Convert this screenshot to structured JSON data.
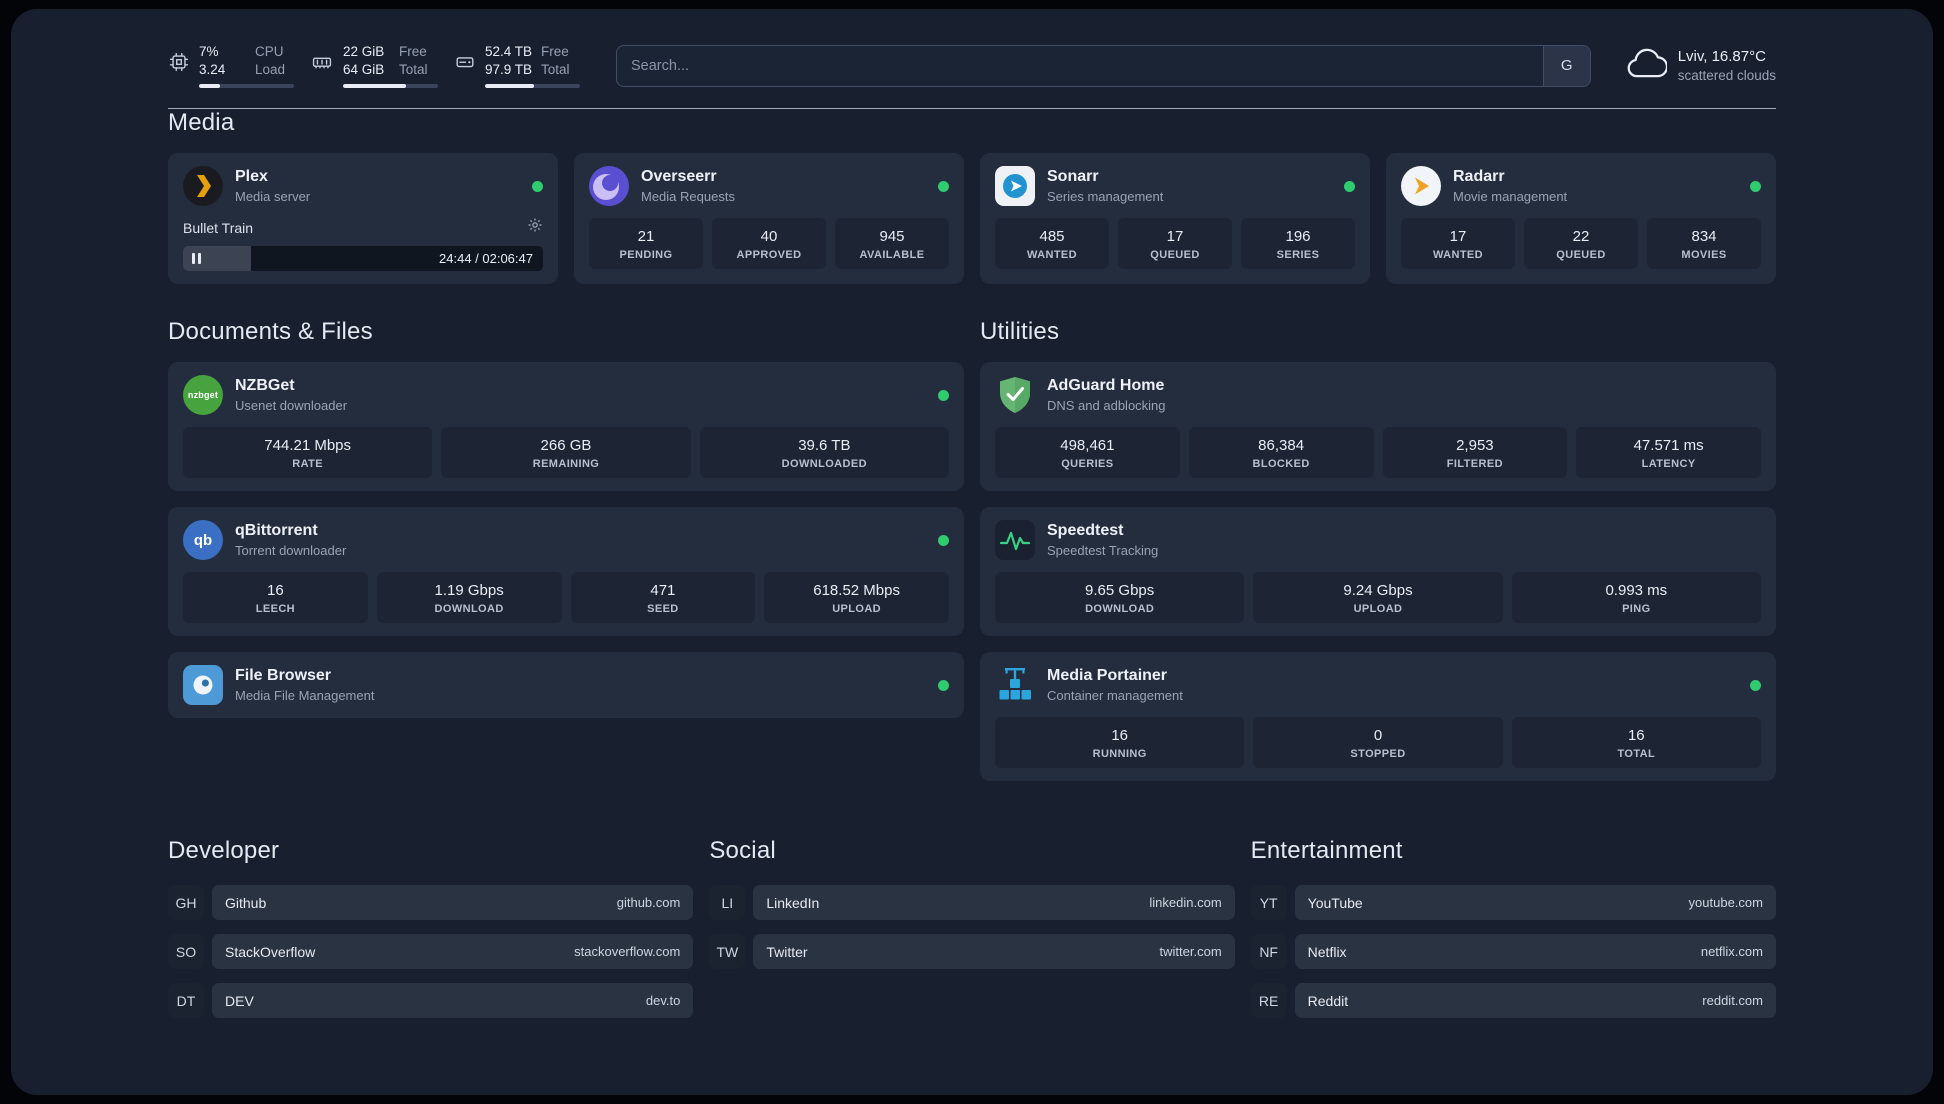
{
  "topbar": {
    "stats": [
      {
        "row1_value": "7%",
        "row1_label": "CPU",
        "row2_value": "3.24",
        "row2_label": "Load",
        "progress": 22
      },
      {
        "row1_value": "22 GiB",
        "row1_label": "Free",
        "row2_value": "64 GiB",
        "row2_label": "Total",
        "progress": 66
      },
      {
        "row1_value": "52.4 TB",
        "row1_label": "Free",
        "row2_value": "97.9 TB",
        "row2_label": "Total",
        "progress": 52
      }
    ],
    "search": {
      "placeholder": "Search...",
      "button_label": "G"
    },
    "weather": {
      "location": "Lviv, 16.87°C",
      "condition": "scattered clouds"
    }
  },
  "media": {
    "heading": "Media",
    "plex": {
      "name": "Plex",
      "subtitle": "Media server",
      "now_playing": "Bullet Train",
      "time": "24:44 / 02:06:47",
      "progress": 19
    },
    "overseerr": {
      "name": "Overseerr",
      "subtitle": "Media Requests",
      "stats": [
        {
          "value": "21",
          "label": "PENDING"
        },
        {
          "value": "40",
          "label": "APPROVED"
        },
        {
          "value": "945",
          "label": "AVAILABLE"
        }
      ]
    },
    "sonarr": {
      "name": "Sonarr",
      "subtitle": "Series management",
      "stats": [
        {
          "value": "485",
          "label": "WANTED"
        },
        {
          "value": "17",
          "label": "QUEUED"
        },
        {
          "value": "196",
          "label": "SERIES"
        }
      ]
    },
    "radarr": {
      "name": "Radarr",
      "subtitle": "Movie management",
      "stats": [
        {
          "value": "17",
          "label": "WANTED"
        },
        {
          "value": "22",
          "label": "QUEUED"
        },
        {
          "value": "834",
          "label": "MOVIES"
        }
      ]
    }
  },
  "documents": {
    "heading": "Documents & Files",
    "nzbget": {
      "name": "NZBGet",
      "subtitle": "Usenet downloader",
      "stats": [
        {
          "value": "744.21 Mbps",
          "label": "RATE"
        },
        {
          "value": "266 GB",
          "label": "REMAINING"
        },
        {
          "value": "39.6 TB",
          "label": "DOWNLOADED"
        }
      ]
    },
    "qbittorrent": {
      "name": "qBittorrent",
      "subtitle": "Torrent downloader",
      "stats": [
        {
          "value": "16",
          "label": "LEECH"
        },
        {
          "value": "1.19 Gbps",
          "label": "DOWNLOAD"
        },
        {
          "value": "471",
          "label": "SEED"
        },
        {
          "value": "618.52 Mbps",
          "label": "UPLOAD"
        }
      ]
    },
    "filebrowser": {
      "name": "File Browser",
      "subtitle": "Media File Management"
    }
  },
  "utilities": {
    "heading": "Utilities",
    "adguard": {
      "name": "AdGuard Home",
      "subtitle": "DNS and adblocking",
      "stats": [
        {
          "value": "498,461",
          "label": "QUERIES"
        },
        {
          "value": "86,384",
          "label": "BLOCKED"
        },
        {
          "value": "2,953",
          "label": "FILTERED"
        },
        {
          "value": "47.571 ms",
          "label": "LATENCY"
        }
      ]
    },
    "speedtest": {
      "name": "Speedtest",
      "subtitle": "Speedtest Tracking",
      "stats": [
        {
          "value": "9.65 Gbps",
          "label": "DOWNLOAD"
        },
        {
          "value": "9.24 Gbps",
          "label": "UPLOAD"
        },
        {
          "value": "0.993 ms",
          "label": "PING"
        }
      ]
    },
    "portainer": {
      "name": "Media Portainer",
      "subtitle": "Container management",
      "stats": [
        {
          "value": "16",
          "label": "RUNNING"
        },
        {
          "value": "0",
          "label": "STOPPED"
        },
        {
          "value": "16",
          "label": "TOTAL"
        }
      ]
    }
  },
  "bookmarks": {
    "developer": {
      "heading": "Developer",
      "items": [
        {
          "abbr": "GH",
          "name": "Github",
          "domain": "github.com"
        },
        {
          "abbr": "SO",
          "name": "StackOverflow",
          "domain": "stackoverflow.com"
        },
        {
          "abbr": "DT",
          "name": "DEV",
          "domain": "dev.to"
        }
      ]
    },
    "social": {
      "heading": "Social",
      "items": [
        {
          "abbr": "LI",
          "name": "LinkedIn",
          "domain": "linkedin.com"
        },
        {
          "abbr": "TW",
          "name": "Twitter",
          "domain": "twitter.com"
        }
      ]
    },
    "entertainment": {
      "heading": "Entertainment",
      "items": [
        {
          "abbr": "YT",
          "name": "YouTube",
          "domain": "youtube.com"
        },
        {
          "abbr": "NF",
          "name": "Netflix",
          "domain": "netflix.com"
        },
        {
          "abbr": "RE",
          "name": "Reddit",
          "domain": "reddit.com"
        }
      ]
    }
  },
  "icons": {
    "nzbget_label": "nzbget",
    "qbittorrent_label": "qb"
  },
  "colors": {
    "status_green": "#2fcb6f",
    "plex_gold": "#e5a00d"
  }
}
